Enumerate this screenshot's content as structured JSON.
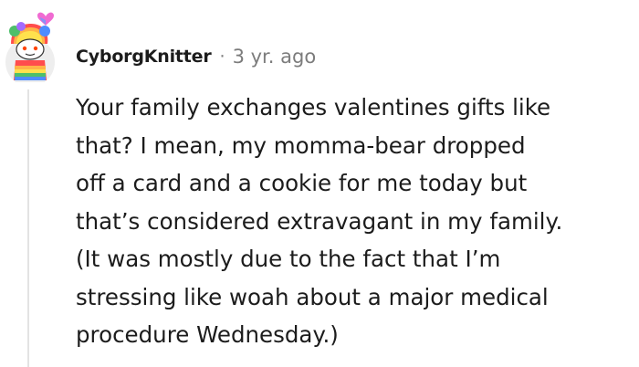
{
  "comment": {
    "username": "CyborgKnitter",
    "separator": "·",
    "timestamp": "3 yr. ago",
    "avatar_icon": "snoo-rainbow-avatar-icon",
    "body_lines": [
      "Your family exchanges valentines gifts like",
      "that? I mean, my momma-bear dropped",
      "off a card and a cookie for me today but",
      "that’s considered extravagant in my family.",
      "(It was mostly due to the fact that I’m",
      "stressing like woah about a major medical",
      "procedure Wednesday.)"
    ]
  },
  "colors": {
    "text": "#1c1c1c",
    "meta": "#7c7c7c",
    "thread_line": "#e3e3e3"
  }
}
